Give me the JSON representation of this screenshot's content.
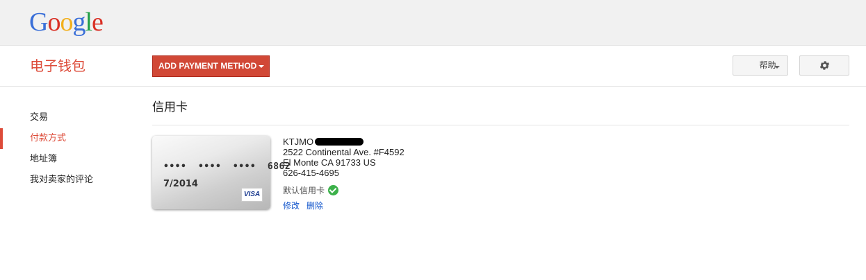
{
  "header": {
    "logo_text": "Google"
  },
  "app": {
    "title": "电子钱包",
    "add_button_label": "ADD PAYMENT METHOD",
    "help_button_label": "帮助",
    "settings_icon": "gear-icon"
  },
  "sidebar": {
    "items": [
      {
        "label": "交易",
        "active": false
      },
      {
        "label": "付款方式",
        "active": true
      },
      {
        "label": "地址簿",
        "active": false
      },
      {
        "label": "我对卖家的评论",
        "active": false
      }
    ]
  },
  "main": {
    "section_title": "信用卡",
    "card": {
      "number_masked": "••••  ••••  ••••  6862",
      "expiry": "7/2014",
      "brand": "VISA"
    },
    "card_details": {
      "name": "KTJMO",
      "address_line1": "2522 Continental Ave. #F4592",
      "address_line2": "El Monte CA 91733 US",
      "phone": "626-415-4695",
      "default_label": "默认信用卡",
      "edit_label": "修改",
      "delete_label": "删除"
    }
  },
  "colors": {
    "accent_red": "#dd4b39",
    "button_red": "#d14836",
    "link_blue": "#1155cc",
    "check_green": "#3cb14a"
  }
}
